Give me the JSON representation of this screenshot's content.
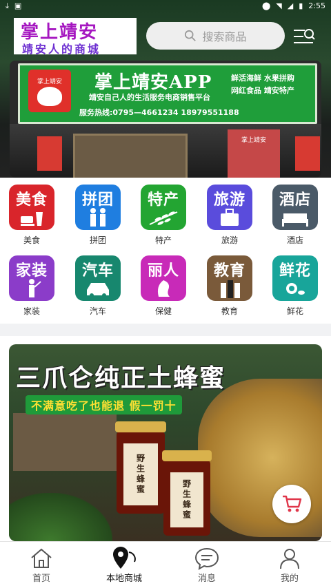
{
  "status_bar": {
    "time": "2:55"
  },
  "brand": {
    "line1": "掌上靖安",
    "line2": "靖安人的商城"
  },
  "search": {
    "placeholder": "搜索商品"
  },
  "hero": {
    "sign_logo_text": "掌上靖安",
    "sign_title": "掌上靖安APP",
    "sign_subtitle": "靖安自己人的生活服务电商销售平台",
    "sign_phone": "服务热线:0795—4661234  18979551188",
    "sign_tags_1": "鲜活海鲜  水果拼购",
    "sign_tags_2": "网红食品  靖安特产",
    "store_ad": "掌上靖安"
  },
  "categories": [
    {
      "tile_text": "美食",
      "label": "美食",
      "color": "#d9252b",
      "icon": "food-icon"
    },
    {
      "tile_text": "拼团",
      "label": "拼团",
      "color": "#1f7ee0",
      "icon": "group-icon"
    },
    {
      "tile_text": "特产",
      "label": "特产",
      "color": "#23a532",
      "icon": "wheat-icon"
    },
    {
      "tile_text": "旅游",
      "label": "旅游",
      "color": "#5a4cdc",
      "icon": "luggage-icon"
    },
    {
      "tile_text": "酒店",
      "label": "酒店",
      "color": "#4a5a68",
      "icon": "bed-icon"
    },
    {
      "tile_text": "家装",
      "label": "家装",
      "color": "#8b3cc9",
      "icon": "worker-icon"
    },
    {
      "tile_text": "汽车",
      "label": "汽车",
      "color": "#17876e",
      "icon": "car-icon"
    },
    {
      "tile_text": "丽人",
      "label": "保健",
      "color": "#c82ab8",
      "icon": "woman-icon"
    },
    {
      "tile_text": "教育",
      "label": "教育",
      "color": "#7a5a3a",
      "icon": "books-icon"
    },
    {
      "tile_text": "鲜花",
      "label": "鲜花",
      "color": "#18a59a",
      "icon": "flower-icon"
    }
  ],
  "promo": {
    "headline": "三爪仑纯正土蜂蜜",
    "slogan": "不满意吃了也能退  假一罚十",
    "jar_label": "野生蜂蜜"
  },
  "tabs": [
    {
      "label": "首页",
      "icon": "home-icon"
    },
    {
      "label": "本地商城",
      "icon": "location-icon",
      "active": true
    },
    {
      "label": "消息",
      "icon": "message-icon"
    },
    {
      "label": "我的",
      "icon": "user-icon"
    }
  ]
}
